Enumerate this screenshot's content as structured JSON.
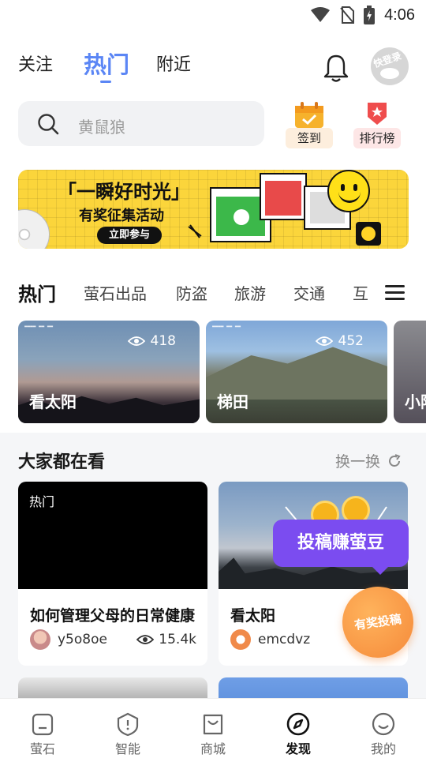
{
  "status_bar": {
    "time": "4:06",
    "icons": [
      "wifi-icon",
      "no-sim-icon",
      "battery-charging-icon"
    ]
  },
  "top_tabs": [
    {
      "label": "关注",
      "active": false
    },
    {
      "label": "热门",
      "active": true
    },
    {
      "label": "附近",
      "active": false
    }
  ],
  "header_icons": {
    "bell": "bell-icon",
    "avatar_text": "快登录"
  },
  "search": {
    "placeholder": "黄鼠狼"
  },
  "quick_actions": [
    {
      "label": "签到",
      "icon": "calendar-check-icon",
      "bg": "#fdeedd"
    },
    {
      "label": "排行榜",
      "icon": "rank-badge-icon",
      "bg": "#fde6e6"
    }
  ],
  "banner": {
    "title": "「一瞬好时光」",
    "subtitle": "有奖征集活动",
    "button": "立即参与"
  },
  "categories": [
    {
      "label": "热门",
      "active": true
    },
    {
      "label": "萤石出品"
    },
    {
      "label": "防盗"
    },
    {
      "label": "旅游"
    },
    {
      "label": "交通"
    },
    {
      "label": "互"
    }
  ],
  "hot_thumbs": [
    {
      "title": "看太阳",
      "views": "418"
    },
    {
      "title": "梯田",
      "views": "452"
    },
    {
      "title": "小阳"
    }
  ],
  "section": {
    "title": "大家都在看",
    "refresh": "换一换"
  },
  "cards": [
    {
      "tag": "热门",
      "title": "如何管理父母的日常健康",
      "author": "y5o8oe",
      "views": "15.4k"
    },
    {
      "title": "看太阳",
      "author": "emcdvz"
    }
  ],
  "promo": {
    "bubble": "投稿赚萤豆",
    "fab": "有奖投稿"
  },
  "bottom_nav": [
    {
      "label": "萤石",
      "icon": "home-icon"
    },
    {
      "label": "智能",
      "icon": "shield-icon"
    },
    {
      "label": "商城",
      "icon": "shopping-bag-icon"
    },
    {
      "label": "发现",
      "icon": "compass-icon",
      "active": true
    },
    {
      "label": "我的",
      "icon": "smile-face-icon"
    }
  ],
  "colors": {
    "accent": "#5b86f5",
    "promo": "#7b4cf0",
    "fab": "#f58a3a",
    "banner": "#fbd53b"
  }
}
